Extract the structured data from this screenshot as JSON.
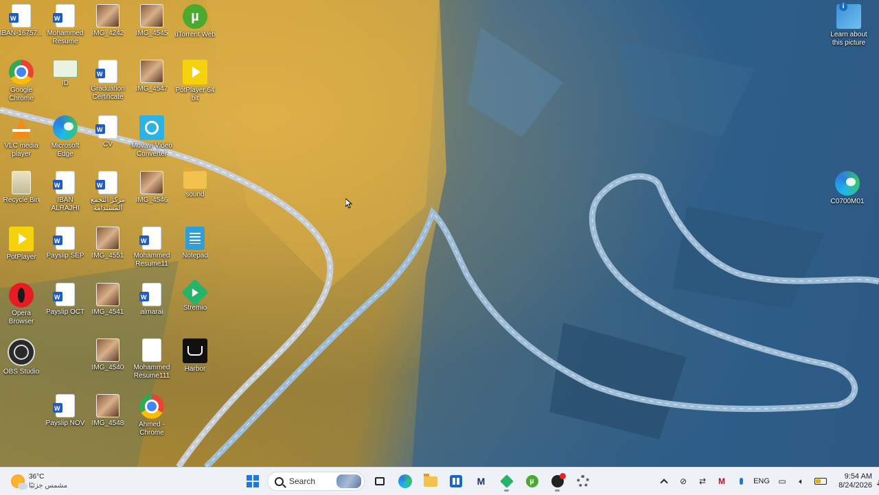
{
  "desktop": {
    "icons": [
      {
        "label": "IBAN-16757...",
        "icon": "word-doc-icon"
      },
      {
        "label": "Mohammed Resume",
        "icon": "word-doc-icon"
      },
      {
        "label": "IMG_4242",
        "icon": "photo-icon"
      },
      {
        "label": "IMG_4545",
        "icon": "photo-icon"
      },
      {
        "label": "uTorrent Web",
        "icon": "utorrent-icon"
      },
      {
        "label": "Google Chrome",
        "icon": "chrome-icon"
      },
      {
        "label": "ID",
        "icon": "id-card-icon"
      },
      {
        "label": "Graduation Certificate",
        "icon": "word-doc-icon"
      },
      {
        "label": "IMG_4547",
        "icon": "photo-icon"
      },
      {
        "label": "PotPlayer 64 bit",
        "icon": "potplayer-icon"
      },
      {
        "label": "VLC media player",
        "icon": "vlc-icon"
      },
      {
        "label": "Microsoft Edge",
        "icon": "edge-icon"
      },
      {
        "label": "CV",
        "icon": "word-doc-icon"
      },
      {
        "label": "Movavi Video Converter",
        "icon": "movavi-icon"
      },
      {
        "label": "Recycle Bin",
        "icon": "recycle-bin-icon"
      },
      {
        "label": "IBAN ALRAJHI",
        "icon": "word-doc-icon"
      },
      {
        "label": "مركز التجمع المستدامة",
        "icon": "word-doc-icon"
      },
      {
        "label": "IMG_4546",
        "icon": "photo-icon"
      },
      {
        "label": "sound",
        "icon": "folder-icon"
      },
      {
        "label": "PotPlayer",
        "icon": "potplayer-icon"
      },
      {
        "label": "Payslip SEP",
        "icon": "word-doc-icon"
      },
      {
        "label": "IMG_4551",
        "icon": "photo-icon"
      },
      {
        "label": "Mohammed Resume11",
        "icon": "word-doc-icon"
      },
      {
        "label": "Notepad",
        "icon": "notepad-icon"
      },
      {
        "label": "Opera Browser",
        "icon": "opera-icon"
      },
      {
        "label": "Payslip OCT",
        "icon": "word-doc-icon"
      },
      {
        "label": "IMG_4541",
        "icon": "photo-icon"
      },
      {
        "label": "almarai",
        "icon": "word-doc-icon"
      },
      {
        "label": "Stremio",
        "icon": "stremio-icon"
      },
      {
        "label": "OBS Studio",
        "icon": "obs-icon"
      },
      {
        "label": "IMG_4540",
        "icon": "photo-icon"
      },
      {
        "label": "Mohammed Resume111",
        "icon": "blank-doc-icon"
      },
      {
        "label": "Harbor",
        "icon": "harbor-icon"
      },
      {
        "label": "Payslip NOV",
        "icon": "word-doc-icon"
      },
      {
        "label": "IMG_4548",
        "icon": "photo-icon"
      },
      {
        "label": "Ahmed - Chrome",
        "icon": "chrome-icon"
      }
    ],
    "right_icons": [
      {
        "label": "Learn about this picture",
        "icon": "learn-picture-icon"
      },
      {
        "label": "C0700M01",
        "icon": "edge-icon"
      }
    ]
  },
  "taskbar": {
    "weather": {
      "temp": "36°C",
      "condition": "مشمس جزئيًا"
    },
    "search_label": "Search",
    "tray": {
      "language": "ENG",
      "time": "9:54 AM",
      "date": "8/24/2026"
    }
  },
  "colors": {
    "taskbar_bg": "#eef1f6",
    "accent": "#1a78e0"
  }
}
